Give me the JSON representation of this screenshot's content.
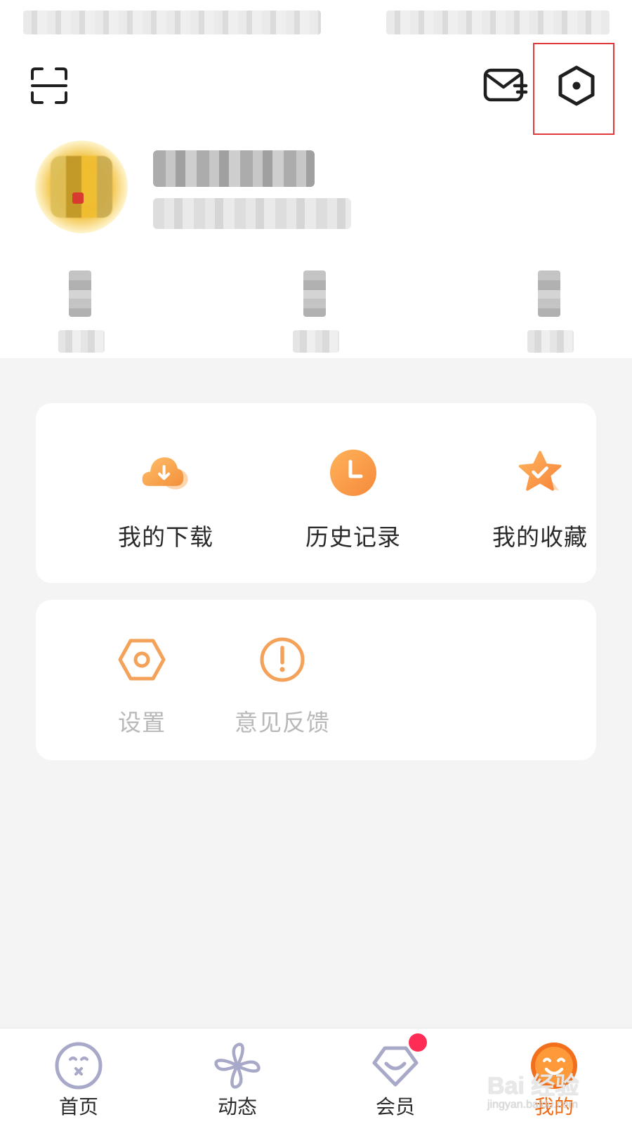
{
  "colors": {
    "accent": "#f6a04a",
    "accent_dark": "#f06a15",
    "background": "#f4f4f4",
    "card": "#ffffff",
    "text_dark": "#2a2a2a",
    "text_muted": "#b8b8b8",
    "highlight_box": "#e23a3a",
    "badge": "#ff2d55",
    "nav_icon": "#a8a8c8"
  },
  "header": {
    "scan_icon": "scan-icon",
    "mail_icon": "mail-icon",
    "settings_icon": "settings-hexagon-icon"
  },
  "quick_actions": [
    {
      "label": "我的下载",
      "icon": "download-cloud-icon"
    },
    {
      "label": "历史记录",
      "icon": "clock-icon"
    },
    {
      "label": "我的收藏",
      "icon": "star-check-icon"
    }
  ],
  "tools": [
    {
      "label": "设置",
      "icon": "gear-hexagon-icon"
    },
    {
      "label": "意见反馈",
      "icon": "exclamation-circle-icon"
    }
  ],
  "bottom_nav": [
    {
      "label": "首页",
      "icon": "home-face-icon"
    },
    {
      "label": "动态",
      "icon": "pinwheel-icon"
    },
    {
      "label": "会员",
      "icon": "member-diamond-icon"
    },
    {
      "label": "我的",
      "icon": "mine-face-icon",
      "active": true
    }
  ],
  "watermark": {
    "top": "Bai 经验",
    "bottom": "jingyan.baidu.com"
  }
}
